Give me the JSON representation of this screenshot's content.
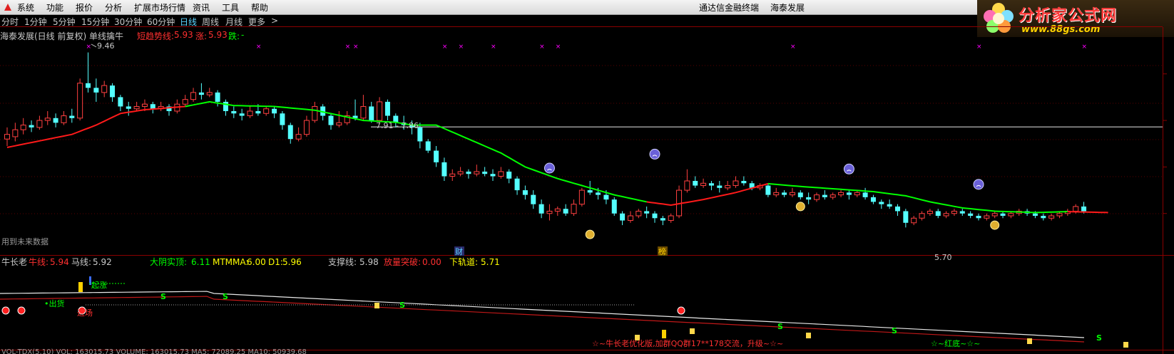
{
  "menu": {
    "items": [
      "系统",
      "功能",
      "报价",
      "分析",
      "扩展市场行情",
      "资讯",
      "工具",
      "帮助"
    ],
    "terminal_title": "通达信金融终端",
    "stock_title": "海泰发展"
  },
  "periods": [
    "分时",
    "1分钟",
    "5分钟",
    "15分钟",
    "30分钟",
    "60分钟",
    "日线",
    "周线",
    "月线",
    "更多",
    ">"
  ],
  "active_period": "日线",
  "logo": {
    "name": "分析家公式网",
    "url": "www.88gs.com"
  },
  "main_info": {
    "prefix": "海泰发展(日线 前复权) 单线擒牛",
    "short_trend_label": "短趋势线:",
    "short_trend_value": "5.93",
    "rise_label": "涨:",
    "rise_value": "5.93",
    "fall_label": "跌:",
    "fall_value": "-"
  },
  "annotations": {
    "high_label": "9.46",
    "line_label": "7.91 - 7.86",
    "low_label": "5.70",
    "future_data_note": "用到未来数据",
    "badge_cai": "财",
    "badge_bang": "榜"
  },
  "sub_info": {
    "title": "牛长老",
    "niu_label": "牛线:",
    "niu_value": "5.94",
    "ma_label": "马线:",
    "ma_value": "5.92",
    "dayin_label": "大阴实顶:",
    "dayin_value": "6.11",
    "mtmma_label": "MTMMA:",
    "mtmma_value": "6.00",
    "d1_label": "D1:",
    "d1_value": "5.96",
    "support_label": "支撑线:",
    "support_value": "5.98",
    "volume_label": "放量突破:",
    "volume_value": "0.00",
    "lower_label": "下轨道:",
    "lower_value": "5.71"
  },
  "sub_annotations": {
    "chuhuo": "•出货",
    "jinchang": "进场",
    "qiqi": "起涨",
    "promo": "☆~牛长老优化版,加群QQ群17**178交流，升级~☆~",
    "hongdi": "☆~红底~☆~",
    "s_mark": "S"
  },
  "bottom_strip": {
    "text": "VOL-TDX(5,10)  VOL: 163015.73   VOLUME: 163015.73   MA5: 72089.25   MA10: 50939.68"
  },
  "colors": {
    "up": "#ff4040",
    "down": "#54ffff",
    "trend_green": "#00ff00",
    "trend_red": "#ff1a1a",
    "axis": "#8b0000",
    "magenta": "#ff00ff",
    "yellow": "#ffff00"
  },
  "chart_data": {
    "type": "candlestick",
    "title": "海泰发展(日线 前复权) 单线擒牛",
    "ylim": [
      5.2,
      9.7
    ],
    "candles": [
      [
        7.6,
        7.7,
        7.85,
        7.45
      ],
      [
        7.65,
        7.8,
        7.95,
        7.55
      ],
      [
        7.8,
        7.9,
        8.05,
        7.7
      ],
      [
        7.9,
        7.85,
        8.0,
        7.75
      ],
      [
        7.85,
        8.0,
        8.1,
        7.8
      ],
      [
        8.0,
        8.05,
        8.2,
        7.9
      ],
      [
        8.05,
        7.95,
        8.15,
        7.85
      ],
      [
        7.95,
        8.1,
        8.2,
        7.9
      ],
      [
        8.1,
        8.05,
        8.25,
        7.95
      ],
      [
        8.05,
        8.8,
        8.9,
        8.0
      ],
      [
        8.8,
        8.7,
        9.46,
        8.6
      ],
      [
        8.7,
        8.6,
        8.9,
        8.4
      ],
      [
        8.6,
        8.75,
        8.85,
        8.5
      ],
      [
        8.75,
        8.5,
        8.8,
        8.4
      ],
      [
        8.5,
        8.3,
        8.55,
        8.2
      ],
      [
        8.3,
        8.25,
        8.4,
        8.1
      ],
      [
        8.25,
        8.3,
        8.4,
        8.2
      ],
      [
        8.3,
        8.35,
        8.45,
        8.2
      ],
      [
        8.35,
        8.25,
        8.4,
        8.15
      ],
      [
        8.25,
        8.3,
        8.4,
        8.2
      ],
      [
        8.3,
        8.2,
        8.35,
        8.1
      ],
      [
        8.2,
        8.35,
        8.45,
        8.15
      ],
      [
        8.35,
        8.45,
        8.55,
        8.3
      ],
      [
        8.45,
        8.6,
        8.7,
        8.4
      ],
      [
        8.6,
        8.55,
        8.8,
        8.45
      ],
      [
        8.55,
        8.6,
        8.7,
        8.5
      ],
      [
        8.6,
        8.4,
        8.65,
        8.3
      ],
      [
        8.4,
        8.2,
        8.45,
        8.1
      ],
      [
        8.2,
        8.15,
        8.3,
        8.05
      ],
      [
        8.15,
        8.1,
        8.25,
        8.0
      ],
      [
        8.1,
        8.2,
        8.3,
        8.05
      ],
      [
        8.2,
        8.15,
        8.35,
        8.1
      ],
      [
        8.15,
        8.25,
        8.3,
        8.1
      ],
      [
        8.25,
        8.15,
        8.3,
        8.05
      ],
      [
        8.15,
        7.9,
        8.2,
        7.8
      ],
      [
        7.9,
        7.6,
        7.95,
        7.5
      ],
      [
        7.6,
        7.7,
        7.85,
        7.55
      ],
      [
        7.7,
        8.0,
        8.1,
        7.65
      ],
      [
        8.0,
        8.3,
        8.4,
        7.95
      ],
      [
        8.3,
        8.1,
        8.35,
        8.0
      ],
      [
        8.1,
        7.9,
        8.15,
        7.8
      ],
      [
        7.9,
        7.95,
        8.2,
        7.85
      ],
      [
        7.95,
        8.1,
        8.2,
        7.9
      ],
      [
        8.1,
        8.05,
        8.45,
        8.0
      ],
      [
        8.05,
        8.3,
        8.55,
        8.0
      ],
      [
        8.3,
        8.0,
        8.4,
        7.95
      ],
      [
        8.0,
        8.4,
        8.5,
        7.95
      ],
      [
        8.4,
        8.1,
        8.45,
        8.0
      ],
      [
        8.1,
        7.95,
        8.15,
        7.85
      ],
      [
        7.95,
        7.9,
        8.1,
        7.8
      ],
      [
        7.9,
        7.85,
        8.0,
        7.7
      ],
      [
        7.85,
        7.55,
        7.95,
        7.4
      ],
      [
        7.55,
        7.35,
        7.6,
        7.3
      ],
      [
        7.35,
        7.1,
        7.45,
        7.0
      ],
      [
        7.1,
        6.8,
        7.2,
        6.7
      ],
      [
        6.8,
        6.85,
        6.95,
        6.7
      ],
      [
        6.85,
        6.9,
        7.0,
        6.8
      ],
      [
        6.9,
        6.85,
        6.95,
        6.75
      ],
      [
        6.85,
        6.9,
        7.05,
        6.8
      ],
      [
        6.9,
        6.85,
        7.0,
        6.8
      ],
      [
        6.85,
        6.8,
        6.95,
        6.7
      ],
      [
        6.8,
        6.9,
        7.0,
        6.75
      ],
      [
        6.9,
        6.75,
        6.95,
        6.65
      ],
      [
        6.75,
        6.5,
        6.8,
        6.4
      ],
      [
        6.5,
        6.4,
        6.6,
        6.3
      ],
      [
        6.4,
        6.2,
        6.5,
        6.1
      ],
      [
        6.2,
        6.0,
        6.3,
        5.9
      ],
      [
        6.0,
        6.05,
        6.2,
        5.85
      ],
      [
        6.05,
        6.1,
        6.15,
        5.95
      ],
      [
        6.1,
        6.0,
        6.2,
        5.95
      ],
      [
        6.0,
        6.2,
        6.3,
        5.95
      ],
      [
        6.2,
        6.5,
        6.55,
        6.15
      ],
      [
        6.5,
        6.45,
        6.7,
        6.4
      ],
      [
        6.45,
        6.4,
        6.55,
        6.3
      ],
      [
        6.4,
        6.3,
        6.5,
        6.2
      ],
      [
        6.3,
        6.0,
        6.35,
        5.95
      ],
      [
        6.0,
        5.85,
        6.05,
        5.75
      ],
      [
        5.85,
        5.95,
        6.05,
        5.8
      ],
      [
        5.95,
        6.05,
        6.1,
        5.9
      ],
      [
        6.05,
        6.0,
        6.15,
        5.9
      ],
      [
        6.0,
        5.9,
        6.05,
        5.8
      ],
      [
        5.9,
        5.85,
        5.95,
        5.75
      ],
      [
        5.85,
        5.95,
        6.0,
        5.8
      ],
      [
        5.95,
        6.5,
        6.6,
        5.9
      ],
      [
        6.5,
        6.7,
        6.95,
        6.45
      ],
      [
        6.7,
        6.6,
        6.8,
        6.55
      ],
      [
        6.6,
        6.65,
        6.75,
        6.55
      ],
      [
        6.65,
        6.6,
        6.7,
        6.5
      ],
      [
        6.6,
        6.55,
        6.7,
        6.45
      ],
      [
        6.55,
        6.6,
        6.7,
        6.5
      ],
      [
        6.6,
        6.7,
        6.8,
        6.55
      ],
      [
        6.7,
        6.65,
        6.8,
        6.6
      ],
      [
        6.65,
        6.55,
        6.7,
        6.5
      ],
      [
        6.55,
        6.6,
        6.65,
        6.5
      ],
      [
        6.6,
        6.4,
        6.65,
        6.35
      ],
      [
        6.4,
        6.45,
        6.55,
        6.35
      ],
      [
        6.45,
        6.4,
        6.5,
        6.35
      ],
      [
        6.4,
        6.45,
        6.55,
        6.35
      ],
      [
        6.45,
        6.35,
        6.5,
        6.3
      ],
      [
        6.35,
        6.3,
        6.45,
        6.2
      ],
      [
        6.3,
        6.4,
        6.45,
        6.25
      ],
      [
        6.4,
        6.35,
        6.5,
        6.3
      ],
      [
        6.35,
        6.4,
        6.45,
        6.3
      ],
      [
        6.4,
        6.45,
        6.5,
        6.35
      ],
      [
        6.45,
        6.4,
        6.5,
        6.3
      ],
      [
        6.4,
        6.45,
        6.5,
        6.35
      ],
      [
        6.45,
        6.35,
        6.55,
        6.3
      ],
      [
        6.35,
        6.25,
        6.4,
        6.2
      ],
      [
        6.25,
        6.2,
        6.3,
        6.1
      ],
      [
        6.2,
        6.15,
        6.3,
        6.1
      ],
      [
        6.15,
        6.05,
        6.2,
        5.95
      ],
      [
        6.05,
        5.8,
        6.1,
        5.7
      ],
      [
        5.8,
        5.9,
        5.95,
        5.75
      ],
      [
        5.9,
        6.0,
        6.05,
        5.85
      ],
      [
        6.0,
        6.05,
        6.1,
        5.95
      ],
      [
        6.05,
        5.95,
        6.1,
        5.9
      ],
      [
        5.95,
        6.0,
        6.05,
        5.9
      ],
      [
        6.0,
        6.05,
        6.1,
        5.95
      ],
      [
        6.05,
        6.0,
        6.1,
        5.95
      ],
      [
        6.0,
        5.95,
        6.05,
        5.9
      ],
      [
        5.95,
        5.9,
        6.0,
        5.85
      ],
      [
        5.9,
        5.95,
        6.0,
        5.85
      ],
      [
        5.95,
        6.0,
        6.05,
        5.9
      ],
      [
        6.0,
        5.95,
        6.05,
        5.9
      ],
      [
        5.95,
        6.0,
        6.05,
        5.9
      ],
      [
        6.0,
        6.05,
        6.1,
        5.95
      ],
      [
        6.05,
        6.0,
        6.1,
        5.95
      ],
      [
        6.0,
        5.95,
        6.05,
        5.9
      ],
      [
        5.95,
        5.9,
        6.0,
        5.85
      ],
      [
        5.9,
        5.95,
        6.0,
        5.85
      ],
      [
        5.95,
        6.0,
        6.05,
        5.9
      ],
      [
        6.0,
        6.05,
        6.1,
        5.95
      ],
      [
        6.05,
        6.15,
        6.2,
        6.0
      ],
      [
        6.15,
        6.05,
        6.25,
        6.0
      ]
    ],
    "trend": [
      [
        0,
        7.42
      ],
      [
        8,
        7.7
      ],
      [
        11,
        7.9
      ],
      [
        14,
        8.15
      ],
      [
        17,
        8.23
      ],
      [
        22,
        8.3
      ],
      [
        25,
        8.4
      ],
      [
        28,
        8.32
      ],
      [
        33,
        8.3
      ],
      [
        38,
        8.22
      ],
      [
        44,
        8.0
      ],
      [
        48,
        7.96
      ],
      [
        50,
        7.9
      ],
      [
        53,
        7.9
      ],
      [
        57,
        7.6
      ],
      [
        61,
        7.3
      ],
      [
        64,
        7.0
      ],
      [
        68,
        6.75
      ],
      [
        72,
        6.55
      ],
      [
        75,
        6.4
      ],
      [
        79,
        6.25
      ],
      [
        82,
        6.18
      ],
      [
        86,
        6.3
      ],
      [
        90,
        6.45
      ],
      [
        94,
        6.64
      ],
      [
        98,
        6.58
      ],
      [
        103,
        6.52
      ],
      [
        107,
        6.47
      ],
      [
        111,
        6.38
      ],
      [
        114,
        6.25
      ],
      [
        118,
        6.12
      ],
      [
        122,
        6.05
      ],
      [
        127,
        6.02
      ],
      [
        131,
        6.04
      ],
      [
        136,
        6.02
      ]
    ],
    "trend_colors_segments": [
      [
        "red",
        0,
        22
      ],
      [
        "green",
        22,
        79
      ],
      [
        "red",
        79,
        94
      ],
      [
        "green",
        94,
        131
      ],
      [
        "red",
        131,
        136
      ]
    ],
    "price_line": 7.86
  }
}
